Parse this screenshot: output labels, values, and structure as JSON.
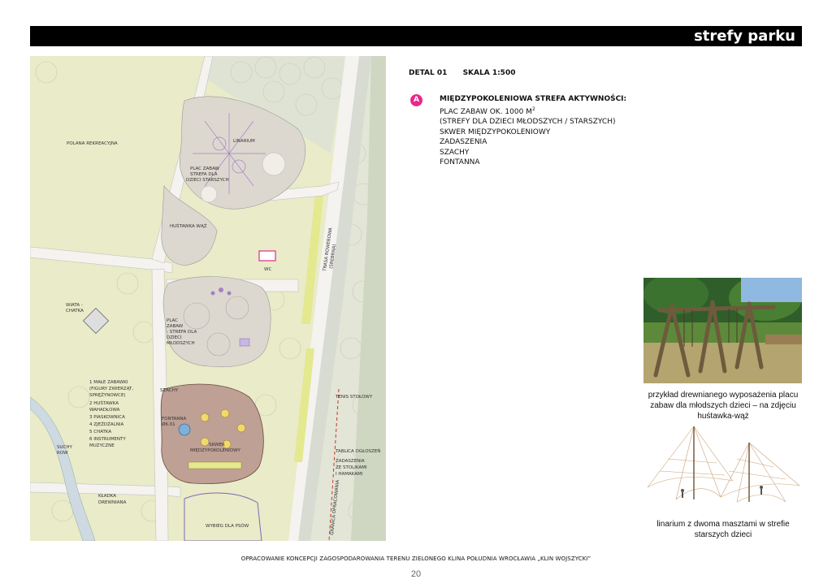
{
  "header": {
    "title": "strefy parku"
  },
  "detail": {
    "label": "DETAL 01",
    "scale": "SKALA 1:500"
  },
  "zone": {
    "marker": "A",
    "title": "MIĘDZYPOKOLENIOWA STREFA AKTYWNOŚCI:",
    "items": [
      "PLAC ZABAW OK. 1000 M",
      "(STREFY DLA DZIECI MŁODSZYCH / STARSZYCH)",
      "SKWER MIĘDZYPOKOLENIOWY",
      "ZADASZENIA",
      "SZACHY",
      "FONTANNA"
    ],
    "superscript": "2"
  },
  "plan": {
    "labels": {
      "polana": "POLANA REKREACYJNA",
      "linarium": "LINARIUM",
      "plac_starsi_1": "PLAC ZABAW",
      "plac_starsi_2": "STREFA DLA",
      "plac_starsi_3": "DZIECI STARSZYCH",
      "hustawka": "HUŚTAWKA WĄŻ",
      "wc": "WC",
      "wiata_1": "WIATA -",
      "wiata_2": "CHATKA",
      "plac_mlodsi_1": "PLAC",
      "plac_mlodsi_2": "ZABAW",
      "plac_mlodsi_3": "- STREFA DLA",
      "plac_mlodsi_4": "DZIECI",
      "plac_mlodsi_5": "MŁODSZYCH",
      "legend_1": "1 MAŁE ZABAWKI",
      "legend_1b": "(FIGURY ZWIERZĄT,",
      "legend_1c": "SPRĘŻYNOWCE)",
      "legend_2": "2 HUŚTAWKA",
      "legend_2b": "WAHADŁOWA",
      "legend_3": "3 PIASKOWNICA",
      "legend_4": "4 ZJEŻDŻALNIA",
      "legend_5": "5 CHATKA",
      "legend_6": "6 INSTRUMENTY",
      "legend_6b": "MUZYCZNE",
      "szachy": "SZACHY",
      "fontanna_1": "FONTANNA",
      "fontanna_2": "Ø6.01",
      "skwer_1": "SKWER",
      "skwer_2": "MIĘDZYPOKOLENIOWY",
      "suchy_1": "SUCHY",
      "suchy_2": "ROW",
      "kladka_1": "KŁADKA",
      "kladka_2": "DREWNIANA",
      "wybieg": "WYBIEG DLA PSÓW",
      "tenis": "TENIS STOŁOWY",
      "tablica": "TABLICA OGŁOSZEŃ",
      "zadaszenia_1": "ZADASZENIA",
      "zadaszenia_2": "ZE STOLIKAMI",
      "zadaszenia_3": "I HAMAKAMI",
      "trasa_1": "TRASA ROWEROWA",
      "trasa_2": "(SREBRNA)",
      "granica": "GRANICA OPRACOWANIA"
    }
  },
  "captions": {
    "photo": "przykład drewnianego wyposażenia placu zabaw dla młodszych dzieci – na zdjęciu huśtawka-wąż",
    "linarium": "linarium z dwoma masztami w strefie starszych dzieci"
  },
  "footer": "OPRACOWANIE KONCEPCJI ZAGOSPODAROWANIA TERENU ZIELONEGO KLINA POŁUDNIA WROCŁAWIA „KLIN WOJSZYCKI”",
  "page_number": "20",
  "colors": {
    "accent": "#e6288c",
    "header_bg": "#000000",
    "meadow": "#e9ebc9",
    "forest": "#dfe3d4",
    "path": "#f4f3f0",
    "plaza": "#bfa094",
    "play": "#ddd8cf"
  }
}
